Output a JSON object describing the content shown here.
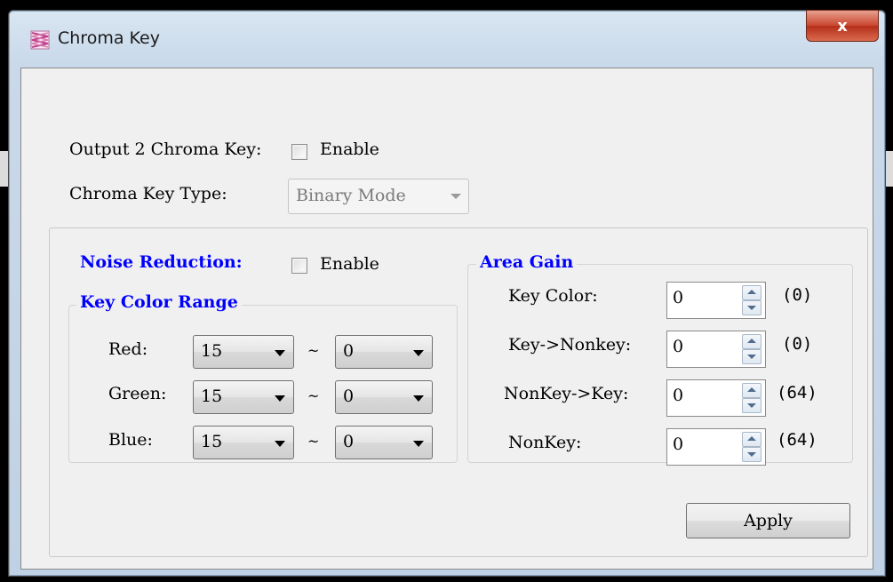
{
  "window": {
    "title": "Chroma Key",
    "close_glyph": "x",
    "icon": "chroma-key-app-icon"
  },
  "output": {
    "label": "Output 2 Chroma Key:",
    "enable_label": "Enable",
    "enabled": false
  },
  "key_type": {
    "label": "Chroma Key Type:",
    "value": "Binary Mode",
    "disabled": true
  },
  "noise": {
    "label": "Noise Reduction:",
    "enable_label": "Enable",
    "enabled": false
  },
  "key_color_range": {
    "title": "Key Color Range",
    "separator": "~",
    "rows": [
      {
        "label": "Red:",
        "from": "15",
        "to": "0"
      },
      {
        "label": "Green:",
        "from": "15",
        "to": "0"
      },
      {
        "label": "Blue:",
        "from": "15",
        "to": "0"
      }
    ]
  },
  "area_gain": {
    "title": "Area Gain",
    "rows": [
      {
        "label": "Key Color:",
        "value": "0",
        "current": "(0)"
      },
      {
        "label": "Key->Nonkey:",
        "value": "0",
        "current": "(0)"
      },
      {
        "label": "NonKey->Key:",
        "value": "0",
        "current": "(64)"
      },
      {
        "label": "NonKey:",
        "value": "0",
        "current": "(64)"
      }
    ]
  },
  "apply_label": "Apply",
  "colors": {
    "group_title": "#0000ff",
    "close_button": "#c8452e",
    "client_bg": "#f0f0f0"
  }
}
